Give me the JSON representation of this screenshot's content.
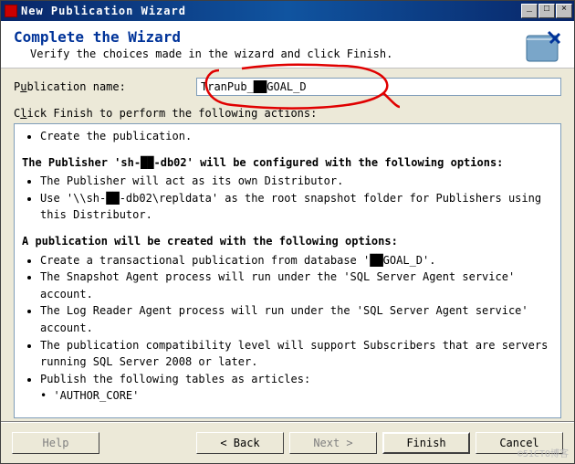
{
  "title": "New Publication Wizard",
  "header": {
    "title": "Complete the Wizard",
    "subtitle": "Verify the choices made in the wizard and click Finish."
  },
  "form": {
    "name_label_pre": "P",
    "name_label_u": "u",
    "name_label_post": "blication name:",
    "name_value": "TranPub_██GOAL_D"
  },
  "actions_label_pre": "C",
  "actions_label_u": "l",
  "actions_label_post": "ick Finish to perform the following actions:",
  "summary": {
    "top_item": "Create the publication.",
    "section1_title": "The Publisher 'sh-██-db02' will be configured with the following options:",
    "section1_items": [
      "The Publisher will act as its own Distributor.",
      "Use '\\\\sh-██-db02\\repldata' as the root snapshot folder for Publishers using this Distributor."
    ],
    "section2_title": "A publication will be created with the following options:",
    "section2_items": [
      "Create a transactional publication from database '██GOAL_D'.",
      "The Snapshot Agent process will run under the 'SQL Server Agent service' account.",
      "The Log Reader Agent process will run under the 'SQL Server Agent service' account.",
      "The publication compatibility level will support Subscribers that are servers running SQL Server 2008 or later.",
      "Publish the following tables as articles:"
    ],
    "articles": [
      "'AUTHOR_CORE'"
    ]
  },
  "buttons": {
    "help": "Help",
    "back": "< Back",
    "next": "Next >",
    "finish": "Finish",
    "cancel": "Cancel"
  },
  "watermark": "©51CTO博客"
}
